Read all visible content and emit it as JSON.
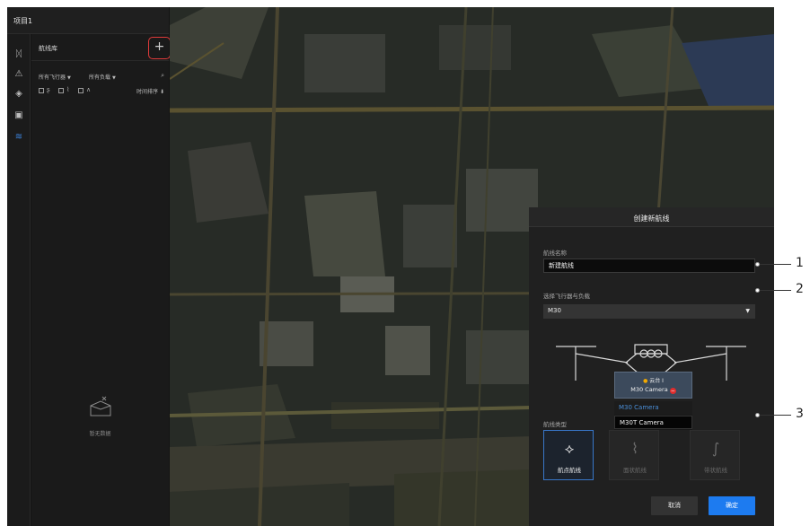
{
  "project": {
    "title": "项目1"
  },
  "rail": {
    "items": [
      {
        "icon": "drone-icon",
        "glyph": "ᛞ"
      },
      {
        "icon": "warning-icon",
        "glyph": "⚠"
      },
      {
        "icon": "layers-icon",
        "glyph": "◈"
      },
      {
        "icon": "media-icon",
        "glyph": "▣"
      },
      {
        "icon": "route-icon",
        "glyph": "≋",
        "active": true
      }
    ]
  },
  "library": {
    "title": "航线库",
    "add_label": "+",
    "filters": {
      "aircraft": "所有飞行器",
      "payload": "所有负载"
    },
    "sort_label": "时间排序",
    "empty_text": "暂无数据",
    "collapse_label": "«"
  },
  "dialog": {
    "title": "创建新航线",
    "name_label": "航线名称",
    "name_value": "新建航线",
    "aircraft_label": "选择飞行器与负载",
    "aircraft_value": "M30",
    "gimbal": {
      "title": "云台 I",
      "camera": "M30 Camera"
    },
    "camera_options": [
      "M30 Camera",
      "M30T Camera"
    ],
    "type_label": "航线类型",
    "types": [
      {
        "label": "航点航线",
        "glyph": "⟡",
        "state": "active"
      },
      {
        "label": "面状航线",
        "glyph": "⌇",
        "state": "disabled"
      },
      {
        "label": "带状航线",
        "glyph": "∫",
        "state": "disabled"
      }
    ],
    "cancel_label": "取消",
    "ok_label": "确定"
  },
  "callouts": [
    "1",
    "2",
    "3"
  ],
  "colors": {
    "accent": "#1d7bf0",
    "highlight_box": "#e03a3a",
    "remove": "#e02d2d"
  }
}
